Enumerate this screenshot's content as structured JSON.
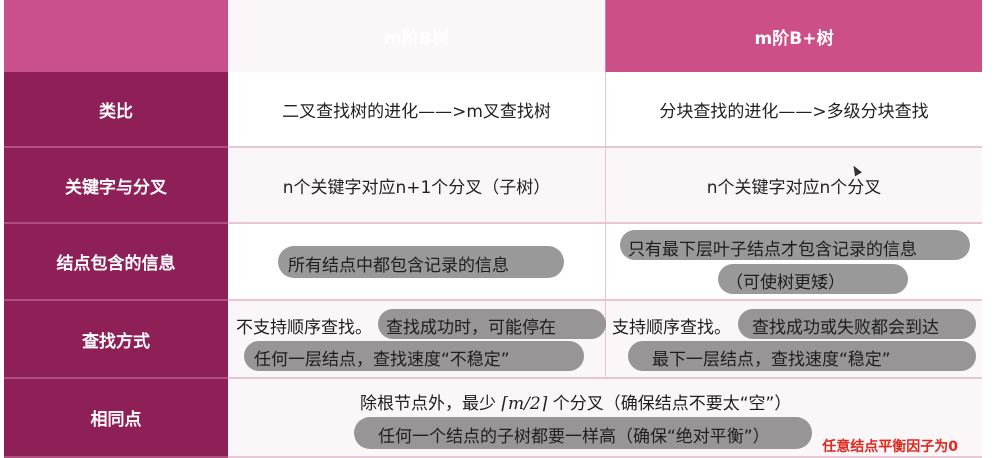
{
  "header": {
    "col0": "",
    "col1": "m阶B树",
    "col2": "m阶B+树"
  },
  "rows": [
    {
      "label": "类比",
      "b": "二叉查找树的进化——>m叉查找树",
      "bplus": "分块查找的进化——>多级分块查找"
    },
    {
      "label": "关键字与分叉",
      "b": "n个关键字对应n+1个分叉（子树）",
      "bplus": "n个关键字对应n个分叉"
    },
    {
      "label": "结点包含的信息",
      "b": "所有结点中都包含记录的信息",
      "bplus_line1": "只有最下层叶子结点才包含记录的信息",
      "bplus_line2": "（可使树更矮）"
    },
    {
      "label": "查找方式",
      "b_line1a": "不支持顺序查找。",
      "b_line1b": "查找成功时，可能停在",
      "b_line2": "任何一层结点，查找速度“不稳定”",
      "bplus_line1a": "支持顺序查找。",
      "bplus_line1b": "查找成功或失败都会到达",
      "bplus_line2": "最下一层结点，查找速度“稳定”"
    },
    {
      "label": "相同点",
      "line1_pre": "除根节点外，最少 ",
      "line1_math": "⌈m/2⌉",
      "line1_post": " 个分叉（确保结点不要太“空”）",
      "line2": "任何一个结点的子树都要一样高（确保“绝对平衡”）"
    }
  ],
  "note": "任意结点平衡因子为0"
}
